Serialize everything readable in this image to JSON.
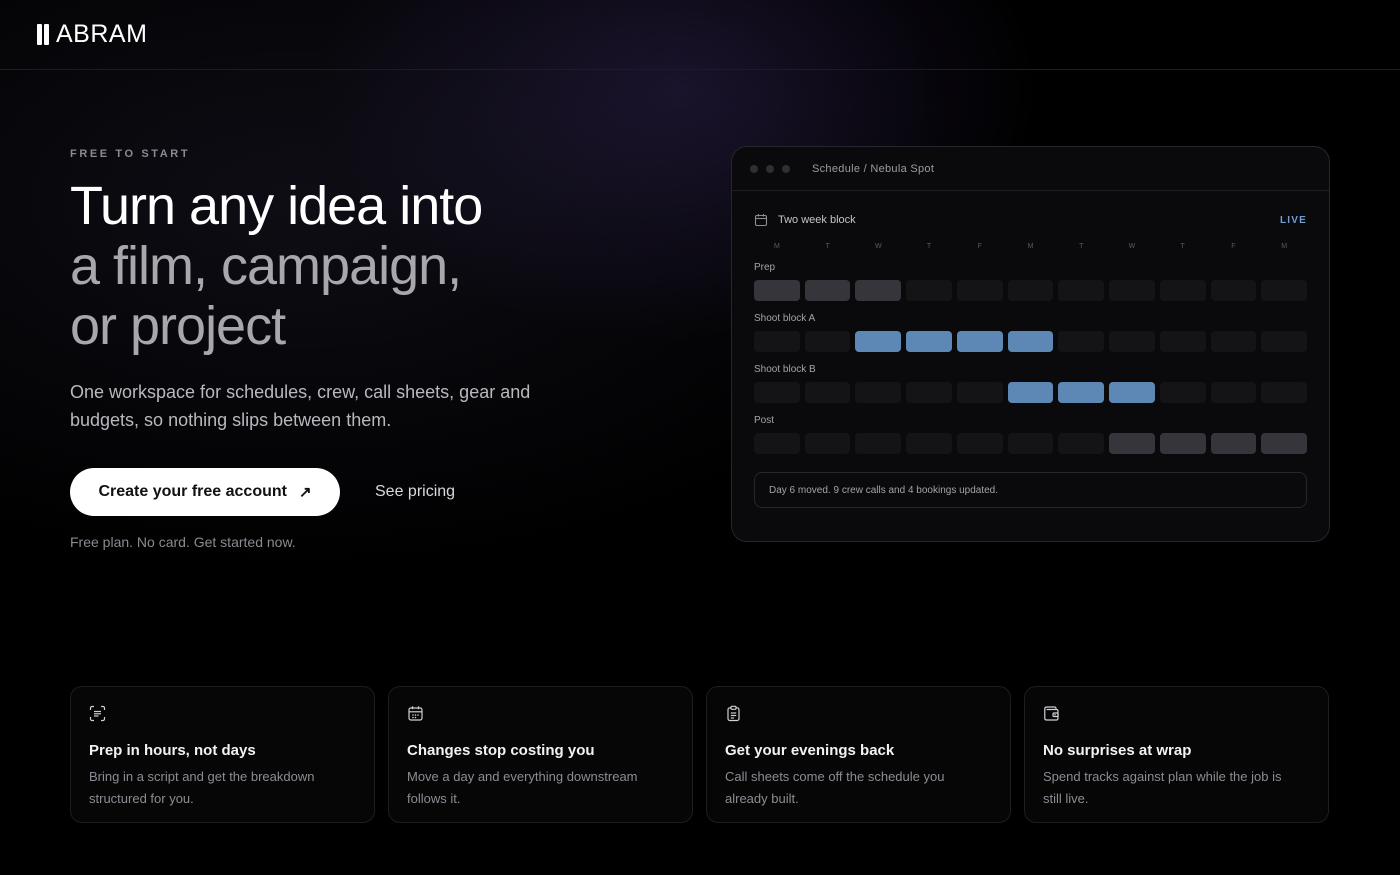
{
  "brand": {
    "name": "ABRAM"
  },
  "hero": {
    "eyebrow": "FREE TO START",
    "headline_l1": "Turn any idea into",
    "headline_l2": "a film, campaign,",
    "headline_l3": "or project",
    "sub": "One workspace for schedules, crew, call sheets, gear and budgets, so nothing slips between them.",
    "cta_primary": "Create your free account",
    "cta_secondary": "See pricing",
    "note": "Free plan. No card. Get started now."
  },
  "panel": {
    "title": "Schedule / Nebula Spot",
    "block_title": "Two week block",
    "live": "LIVE",
    "days": [
      "M",
      "T",
      "W",
      "T",
      "F",
      "M",
      "T",
      "W",
      "T",
      "F",
      "M"
    ],
    "rows": [
      {
        "label": "Prep",
        "cells": [
          "gray",
          "gray",
          "gray",
          "empty",
          "empty",
          "empty",
          "empty",
          "empty",
          "empty",
          "empty",
          "empty"
        ]
      },
      {
        "label": "Shoot block A",
        "cells": [
          "empty",
          "empty",
          "blue",
          "blue",
          "blue",
          "blue",
          "empty",
          "empty",
          "empty",
          "empty",
          "empty"
        ]
      },
      {
        "label": "Shoot block B",
        "cells": [
          "empty",
          "empty",
          "empty",
          "empty",
          "empty",
          "blue",
          "blue",
          "blue",
          "empty",
          "empty",
          "empty"
        ]
      },
      {
        "label": "Post",
        "cells": [
          "empty",
          "empty",
          "empty",
          "empty",
          "empty",
          "empty",
          "empty",
          "gray",
          "gray",
          "gray",
          "gray"
        ]
      }
    ],
    "status": "Day 6 moved. 9 crew calls and 4 bookings updated."
  },
  "features": [
    {
      "icon": "scan-text-icon",
      "title": "Prep in hours, not days",
      "text": "Bring in a script and get the breakdown structured for you."
    },
    {
      "icon": "calendar-icon",
      "title": "Changes stop costing you",
      "text": "Move a day and everything downstream follows it."
    },
    {
      "icon": "clipboard-icon",
      "title": "Get your evenings back",
      "text": "Call sheets come off the schedule you already built."
    },
    {
      "icon": "wallet-icon",
      "title": "No surprises at wrap",
      "text": "Spend tracks against plan while the job is still live."
    }
  ],
  "colors": {
    "accent_blue": "#5d88b6",
    "live": "#6f9fcf",
    "background": "#000000"
  }
}
